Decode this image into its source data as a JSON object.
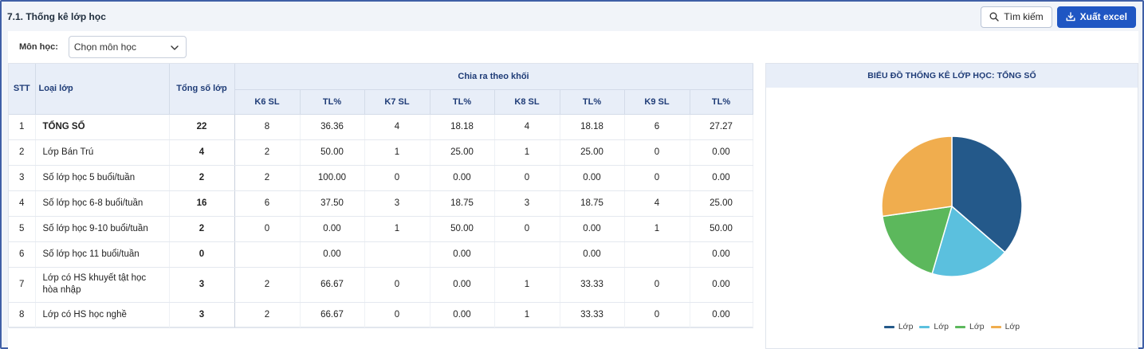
{
  "header": {
    "title": "7.1. Thống kê lớp học",
    "search_label": "Tìm kiếm",
    "export_label": "Xuất excel"
  },
  "filter": {
    "label": "Môn học:",
    "value": "Chọn môn học"
  },
  "table": {
    "headers": {
      "stt": "STT",
      "type": "Loại lớp",
      "total": "Tổng số lớp",
      "group": "Chia ra theo khối",
      "k6": "K6 SL",
      "k6p": "TL%",
      "k7": "K7 SL",
      "k7p": "TL%",
      "k8": "K8 SL",
      "k8p": "TL%",
      "k9": "K9 SL",
      "k9p": "TL%"
    },
    "rows": [
      {
        "stt": "1",
        "name": "TỔNG SỐ",
        "total": "22",
        "k6": "8",
        "k6p": "36.36",
        "k7": "4",
        "k7p": "18.18",
        "k8": "4",
        "k8p": "18.18",
        "k9": "6",
        "k9p": "27.27"
      },
      {
        "stt": "2",
        "name": "Lớp Bán Trú",
        "total": "4",
        "k6": "2",
        "k6p": "50.00",
        "k7": "1",
        "k7p": "25.00",
        "k8": "1",
        "k8p": "25.00",
        "k9": "0",
        "k9p": "0.00"
      },
      {
        "stt": "3",
        "name": "Số lớp học 5 buổi/tuần",
        "total": "2",
        "k6": "2",
        "k6p": "100.00",
        "k7": "0",
        "k7p": "0.00",
        "k8": "0",
        "k8p": "0.00",
        "k9": "0",
        "k9p": "0.00"
      },
      {
        "stt": "4",
        "name": "Số lớp học 6-8 buổi/tuần",
        "total": "16",
        "k6": "6",
        "k6p": "37.50",
        "k7": "3",
        "k7p": "18.75",
        "k8": "3",
        "k8p": "18.75",
        "k9": "4",
        "k9p": "25.00"
      },
      {
        "stt": "5",
        "name": "Số lớp học 9-10 buổi/tuần",
        "total": "2",
        "k6": "0",
        "k6p": "0.00",
        "k7": "1",
        "k7p": "50.00",
        "k8": "0",
        "k8p": "0.00",
        "k9": "1",
        "k9p": "50.00"
      },
      {
        "stt": "6",
        "name": "Số lớp học 11 buổi/tuần",
        "total": "0",
        "k6": "",
        "k6p": "0.00",
        "k7": "",
        "k7p": "0.00",
        "k8": "",
        "k8p": "0.00",
        "k9": "",
        "k9p": "0.00"
      },
      {
        "stt": "7",
        "name": "Lớp có HS khuyết tật học hòa nhập",
        "total": "3",
        "k6": "2",
        "k6p": "66.67",
        "k7": "0",
        "k7p": "0.00",
        "k8": "1",
        "k8p": "33.33",
        "k9": "0",
        "k9p": "0.00"
      },
      {
        "stt": "8",
        "name": "Lớp có HS học nghề",
        "total": "3",
        "k6": "2",
        "k6p": "66.67",
        "k7": "0",
        "k7p": "0.00",
        "k8": "1",
        "k8p": "33.33",
        "k9": "0",
        "k9p": "0.00"
      }
    ]
  },
  "chart_data": {
    "type": "pie",
    "title": "BIỂU ĐỒ THỐNG KÊ LỚP HỌC: TỔNG SỐ",
    "categories": [
      "Lớp",
      "Lớp",
      "Lớp",
      "Lớp"
    ],
    "values": [
      8,
      4,
      4,
      6
    ],
    "colors": [
      "#24598a",
      "#5bc0de",
      "#5cb85c",
      "#f0ad4e"
    ],
    "legend": "bottom"
  }
}
